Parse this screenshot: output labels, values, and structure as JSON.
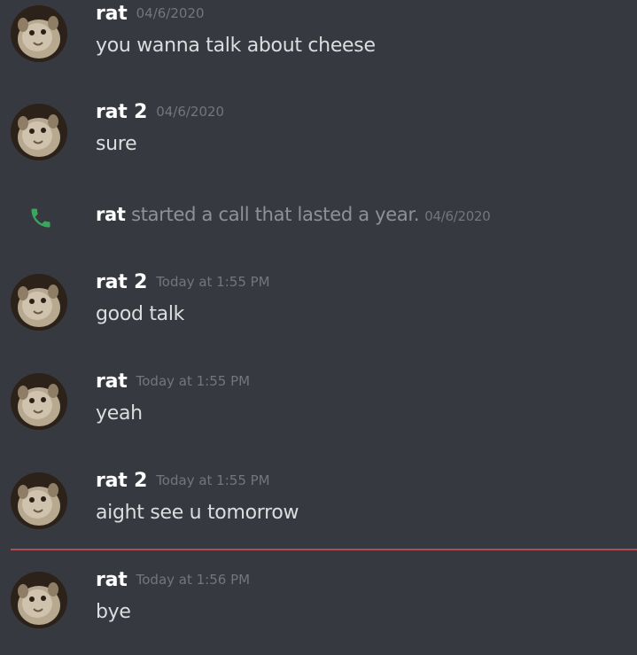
{
  "messages": [
    {
      "user": "rat",
      "timestamp": "04/6/2020",
      "text": "you wanna talk about cheese"
    },
    {
      "user": "rat 2",
      "timestamp": "04/6/2020",
      "text": "sure"
    },
    {
      "user": "rat 2",
      "timestamp": "Today at 1:55 PM",
      "text": "good talk"
    },
    {
      "user": "rat",
      "timestamp": "Today at 1:55 PM",
      "text": "yeah"
    },
    {
      "user": "rat 2",
      "timestamp": "Today at 1:55 PM",
      "text": "aight see u tomorrow"
    },
    {
      "user": "rat",
      "timestamp": "Today at 1:56 PM",
      "text": "bye"
    }
  ],
  "system_message": {
    "user": "rat",
    "text": "started a call that lasted a year.",
    "timestamp": "04/6/2020",
    "icon": "phone-icon"
  },
  "colors": {
    "background": "#36393f",
    "username": "#ffffff",
    "message_text": "#dcddde",
    "timestamp": "#72767d",
    "call_icon": "#3ba55d",
    "new_messages_divider": "#b34a55"
  }
}
